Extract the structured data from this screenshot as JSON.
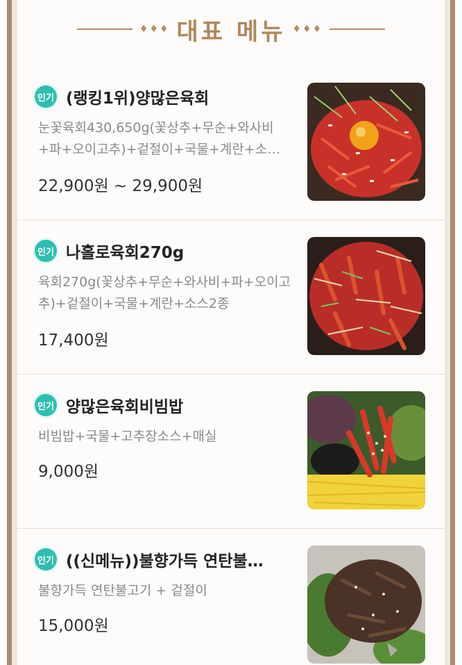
{
  "section": {
    "title": "대표 메뉴",
    "diamonds": "♦♦♦"
  },
  "menu": [
    {
      "badge": "인기",
      "name": "(랭킹1위)양많은육회",
      "description": "눈꽃육회430,650g(꽃상추+무순+와사비+파+오이고추)+겉절이+국물+계란+소…",
      "price": "22,900원 ~ 29,900원",
      "image_icon": "beef-tartare-with-egg-yolk-photo"
    },
    {
      "badge": "인기",
      "name": "나홀로육회270g",
      "description": "육회270g(꽃상추+무순+와사비+파+오이고추)+겉절이+국물+계란+소스2종",
      "price": "17,400원",
      "image_icon": "beef-tartare-photo"
    },
    {
      "badge": "인기",
      "name": "양많은육회비빔밥",
      "description": "비빔밥+국물+고추장소스+매실",
      "price": "9,000원",
      "image_icon": "bibimbap-photo"
    },
    {
      "badge": "인기",
      "name": "((신메뉴))불향가득 연탄불…",
      "description": "불향가득 연탄불고기 + 겉절이",
      "price": "15,000원",
      "image_icon": "bulgogi-photo"
    }
  ],
  "colors": {
    "accent_gold": "#b0885c",
    "badge_teal": "#2fbfb0",
    "frame_brown": "#a98a6f"
  }
}
